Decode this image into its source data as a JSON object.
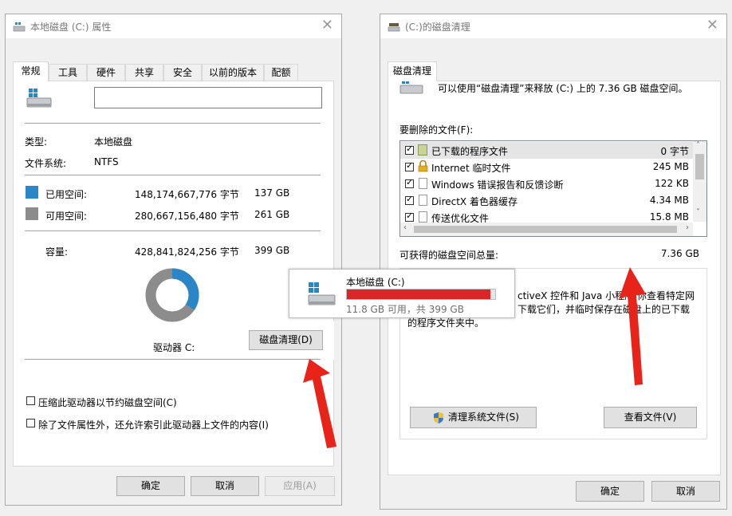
{
  "left_window": {
    "title": "本地磁盘 (C:) 属性",
    "tabs": [
      "常规",
      "工具",
      "硬件",
      "共享",
      "安全",
      "以前的版本",
      "配额"
    ],
    "type_label": "类型:",
    "type_value": "本地磁盘",
    "fs_label": "文件系统:",
    "fs_value": "NTFS",
    "used_label": "已用空间:",
    "used_bytes": "148,174,667,776 字节",
    "used_gb": "137 GB",
    "free_label": "可用空间:",
    "free_bytes": "280,667,156,480 字节",
    "free_gb": "261 GB",
    "capacity_label": "容量:",
    "capacity_bytes": "428,841,824,256 字节",
    "capacity_gb": "399 GB",
    "used_fraction": 0.345,
    "drive_label": "驱动器 C:",
    "cleanup_button": "磁盘清理(D)",
    "compress_label": "压缩此驱动器以节约磁盘空间(C)",
    "index_label": "除了文件属性外，还允许索引此驱动器上文件的内容(I)",
    "ok": "确定",
    "cancel": "取消",
    "apply": "应用(A)",
    "colors": {
      "used": "#2a86c6",
      "free": "#8c8c8c"
    }
  },
  "right_window": {
    "title": "(C:)的磁盘清理",
    "tab": "磁盘清理",
    "intro": "可以使用“磁盘清理”来释放 (C:) 上的 7.36 GB 磁盘空间。",
    "files_label": "要删除的文件(F):",
    "files": [
      {
        "name": "已下载的程序文件",
        "size": "0 字节",
        "checked": true,
        "icon": "folder-icon"
      },
      {
        "name": "Internet 临时文件",
        "size": "245 MB",
        "checked": true,
        "icon": "lock-icon"
      },
      {
        "name": "Windows 错误报告和反馈诊断",
        "size": "122 KB",
        "checked": true,
        "icon": "file-icon"
      },
      {
        "name": "DirectX 着色器缓存",
        "size": "4.34 MB",
        "checked": true,
        "icon": "file-icon"
      },
      {
        "name": "传送优化文件",
        "size": "15.8 MB",
        "checked": true,
        "icon": "file-icon"
      }
    ],
    "total_label": "可获得的磁盘空间总量:",
    "total_value": "7.36 GB",
    "desc_line1": "ctiveX 控件和 Java 小程序 你查看特定网",
    "desc_line2": "下载它们，并临时保存在磁盘上的已下载",
    "desc_line3": "的程序文件夹中。",
    "clean_system_button": "清理系统文件(S)",
    "view_files_button": "查看文件(V)",
    "ok": "确定",
    "cancel": "取消"
  },
  "popup": {
    "drive_name": "本地磁盘 (C:)",
    "space_text": "11.8 GB 可用，共 399 GB",
    "used_fraction": 0.97,
    "bar_color": "#da2626"
  },
  "annotation_color": "#e8231a"
}
